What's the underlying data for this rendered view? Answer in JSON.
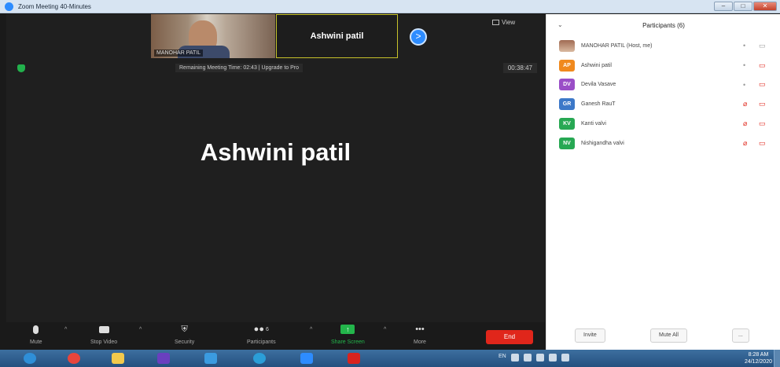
{
  "window": {
    "title": "Zoom Meeting 40-Minutes",
    "buttons": [
      "–",
      "□",
      "✕"
    ]
  },
  "video": {
    "thumbnail_name": "MANOHAR PATIL",
    "active_tile_name": "Ashwini patil",
    "next_button": ">",
    "view_label": "View",
    "remaining_time": "Remaining Meeting Time: 02:43 | Upgrade to Pro",
    "elapsed_timer": "00:38:47",
    "speaker_name": "Ashwini patil"
  },
  "toolbar": {
    "mute": "Mute",
    "stop_video": "Stop Video",
    "security": "Security",
    "participants": "Participants",
    "participants_count": "6",
    "share_screen": "Share Screen",
    "more": "More",
    "more_glyph": "•••",
    "end": "End"
  },
  "participants_panel": {
    "title": "Participants (6)",
    "participants": [
      {
        "initials": "",
        "name": "MANOHAR PATIL (Host, me)",
        "color": "#b07a5e",
        "mic_muted": false,
        "video_off": false
      },
      {
        "initials": "AP",
        "name": "Ashwini patil",
        "color": "#f0891e",
        "mic_muted": false,
        "video_off": true
      },
      {
        "initials": "DV",
        "name": "Devila Vasave",
        "color": "#9a4ec7",
        "mic_muted": false,
        "video_off": true
      },
      {
        "initials": "GR",
        "name": "Ganesh RauT",
        "color": "#3c78c8",
        "mic_muted": true,
        "video_off": true
      },
      {
        "initials": "KV",
        "name": "Kanti valvi",
        "color": "#27a853",
        "mic_muted": true,
        "video_off": true
      },
      {
        "initials": "NV",
        "name": "Nishigandha valvi",
        "color": "#27a853",
        "mic_muted": true,
        "video_off": true
      }
    ],
    "invite": "Invite",
    "mute_all": "Mute All",
    "more": "..."
  },
  "taskbar": {
    "apps": [
      {
        "name": "start-button",
        "color": "#2f8fd8"
      },
      {
        "name": "chrome-app",
        "color": "#e8453c"
      },
      {
        "name": "file-explorer-app",
        "color": "#f2c94c"
      },
      {
        "name": "media-player-app",
        "color": "#6a3fbf"
      },
      {
        "name": "internet-explorer-app",
        "color": "#3b9be0"
      },
      {
        "name": "edge-app",
        "color": "#2b9ed8"
      },
      {
        "name": "zoom-app",
        "color": "#2d8cff"
      },
      {
        "name": "acrobat-app",
        "color": "#d8231e"
      }
    ],
    "language": "EN",
    "time": "8:28 AM",
    "date": "24/12/2020"
  }
}
